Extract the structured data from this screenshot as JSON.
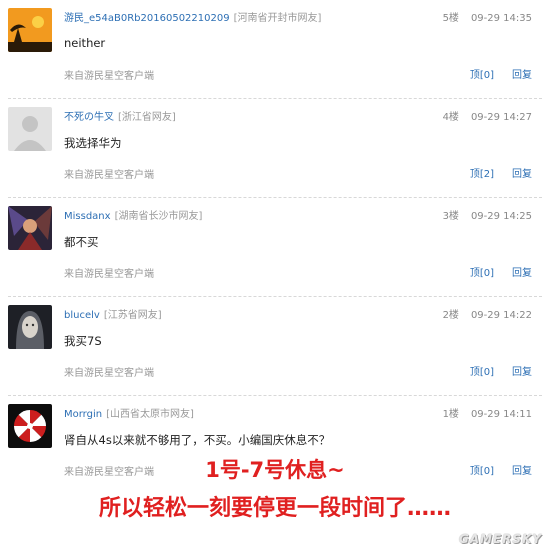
{
  "comments": [
    {
      "username": "游民_e54aB0Rb20160502210209",
      "region": "[河南省开封市网友]",
      "floor": "5楼",
      "time": "09-29 14:35",
      "text": "neither",
      "source": "来自游民星空客户端",
      "like": "顶[0]",
      "reply": "回复",
      "avatar": "avatar-sunset-tree"
    },
    {
      "username": "不死の牛叉",
      "region": "[浙江省网友]",
      "floor": "4楼",
      "time": "09-29 14:27",
      "text": "我选择华为",
      "source": "来自游民星空客户端",
      "like": "顶[2]",
      "reply": "回复",
      "avatar": "avatar-default"
    },
    {
      "username": "Missdanx",
      "region": "[湖南省长沙市网友]",
      "floor": "3楼",
      "time": "09-29 14:25",
      "text": "都不买",
      "source": "来自游民星空客户端",
      "like": "顶[0]",
      "reply": "回复",
      "avatar": "avatar-fantasy-art"
    },
    {
      "username": "blucelv",
      "region": "[江苏省网友]",
      "floor": "2楼",
      "time": "09-29 14:22",
      "text": "我买7S",
      "source": "来自游民星空客户端",
      "like": "顶[0]",
      "reply": "回复",
      "avatar": "avatar-pale-face"
    },
    {
      "username": "Morrgin",
      "region": "[山西省太原市网友]",
      "floor": "1楼",
      "time": "09-29 14:11",
      "text": "肾自从4s以来就不够用了，不买。小编国庆休息不？",
      "source": "来自游民星空客户端",
      "like": "顶[0]",
      "reply": "回复",
      "avatar": "avatar-umbrella-logo"
    }
  ],
  "overlay": {
    "line1": "1号-7号休息~",
    "line2": "所以轻松一刻要停更一段时间了……"
  },
  "watermark": "GAMERSKY",
  "colors": {
    "link": "#2d6fb4",
    "overlay_text": "#e02020",
    "muted": "#999999"
  }
}
